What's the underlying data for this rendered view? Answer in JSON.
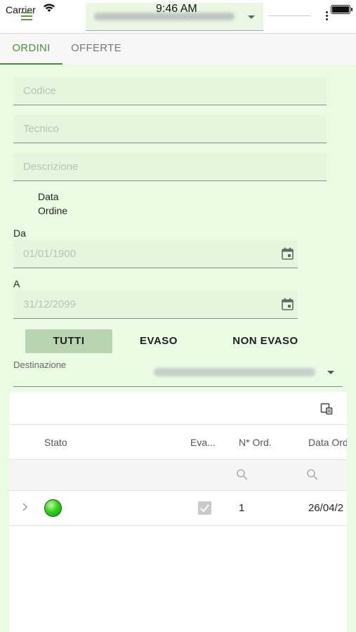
{
  "status_bar": {
    "carrier": "Carrier",
    "time": "9:46 AM"
  },
  "tabs": [
    {
      "label": "ORDINI",
      "active": true
    },
    {
      "label": "OFFERTE",
      "active": false
    }
  ],
  "filters": {
    "codice_placeholder": "Codice",
    "tecnico_placeholder": "Tecnico",
    "descrizione_placeholder": "Descrizione",
    "data_label_line1": "Data",
    "data_label_line2": "Ordine",
    "da_label": "Da",
    "da_value": "01/01/1900",
    "a_label": "A",
    "a_value": "31/12/2099"
  },
  "state_buttons": [
    {
      "label": "TUTTI",
      "selected": true
    },
    {
      "label": "EVASO",
      "selected": false
    },
    {
      "label": "NON EVASO",
      "selected": false
    }
  ],
  "destination": {
    "label": "Destinazione"
  },
  "grid": {
    "columns": [
      "Stato",
      "Eva...",
      "N* Ord.",
      "Data Ord"
    ],
    "rows": [
      {
        "stato_color": "#33d11c",
        "evaso": true,
        "numero": "1",
        "data": "26/04/2"
      }
    ]
  },
  "colors": {
    "accent": "#4a8f32",
    "background": "#eafbe4",
    "field_bg": "#e4f6dd"
  }
}
